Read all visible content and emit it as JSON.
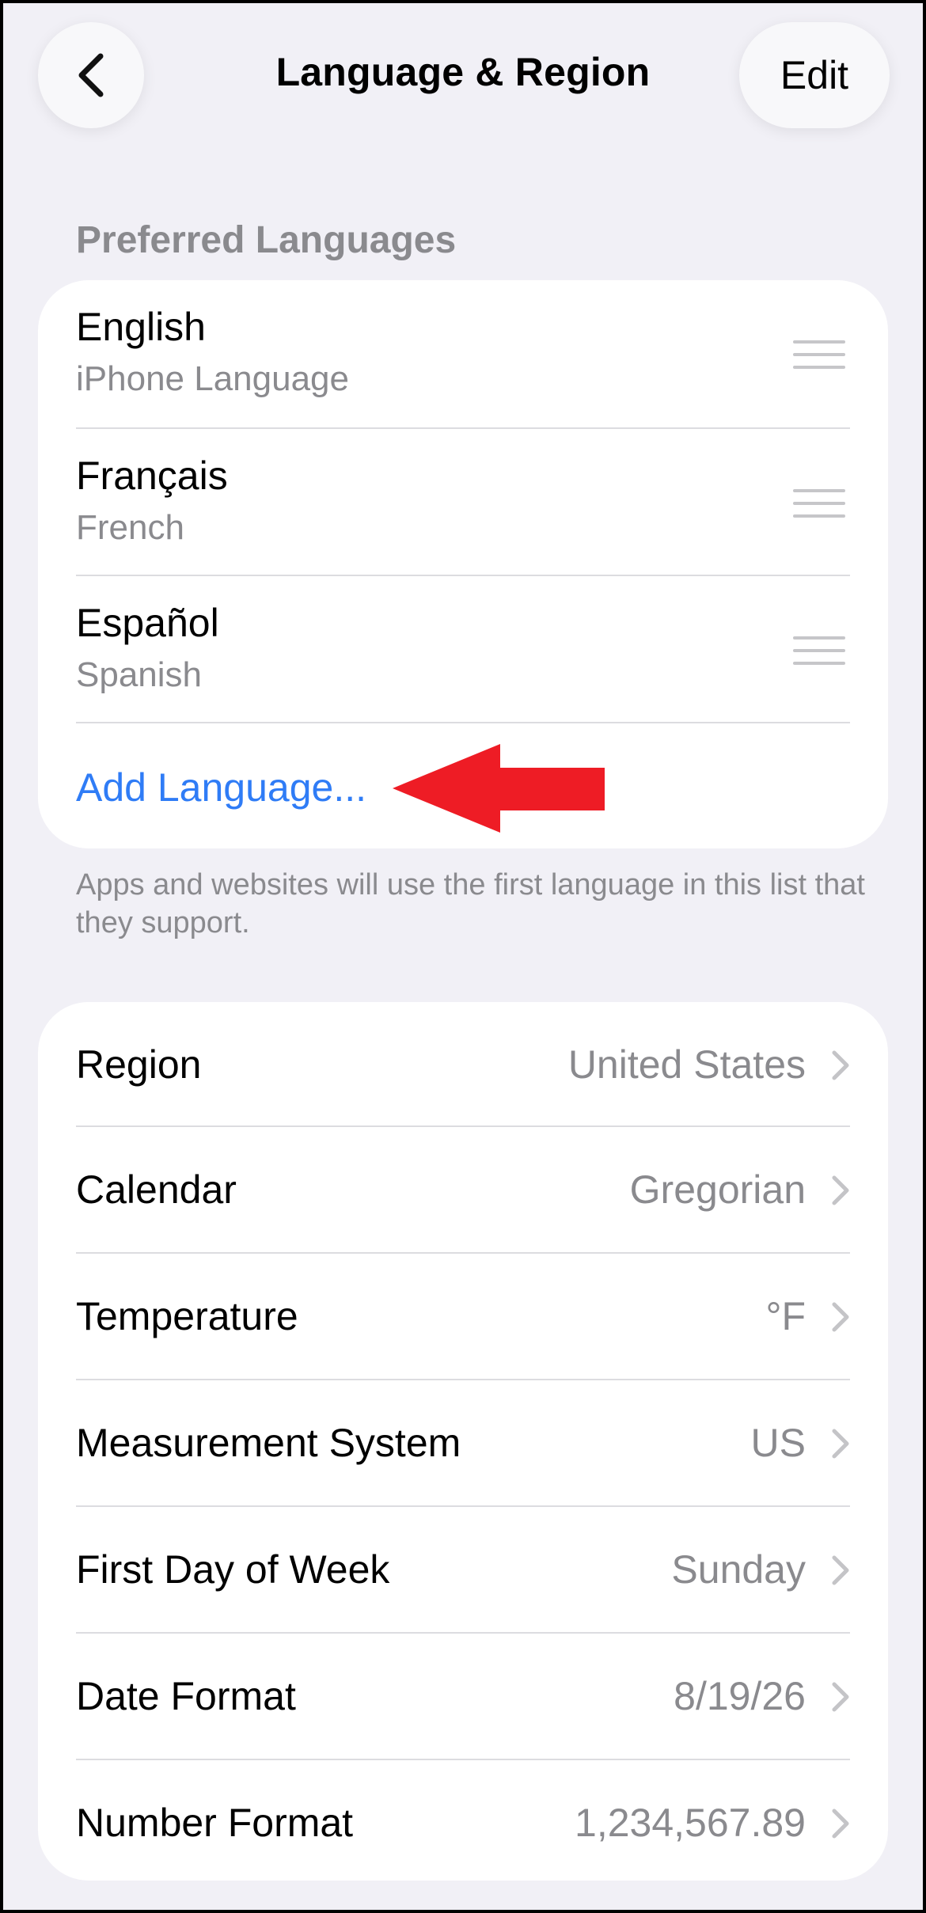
{
  "nav": {
    "title": "Language & Region",
    "edit_label": "Edit",
    "back_icon": "chevron-left-icon"
  },
  "preferred": {
    "header": "Preferred Languages",
    "languages": [
      {
        "name": "English",
        "sub": "iPhone Language"
      },
      {
        "name": "Français",
        "sub": "French"
      },
      {
        "name": "Español",
        "sub": "Spanish"
      }
    ],
    "add_label": "Add Language...",
    "footer": "Apps and websites will use the first language in this list that they support."
  },
  "settings": [
    {
      "label": "Region",
      "value": "United States"
    },
    {
      "label": "Calendar",
      "value": "Gregorian"
    },
    {
      "label": "Temperature",
      "value": "°F"
    },
    {
      "label": "Measurement System",
      "value": "US"
    },
    {
      "label": "First Day of Week",
      "value": "Sunday"
    },
    {
      "label": "Date Format",
      "value": "8/19/26"
    },
    {
      "label": "Number Format",
      "value": "1,234,567.89"
    }
  ],
  "colors": {
    "accent": "#2f7cf6",
    "annotation_arrow": "#ee1c25",
    "background": "#f1f0f6"
  }
}
